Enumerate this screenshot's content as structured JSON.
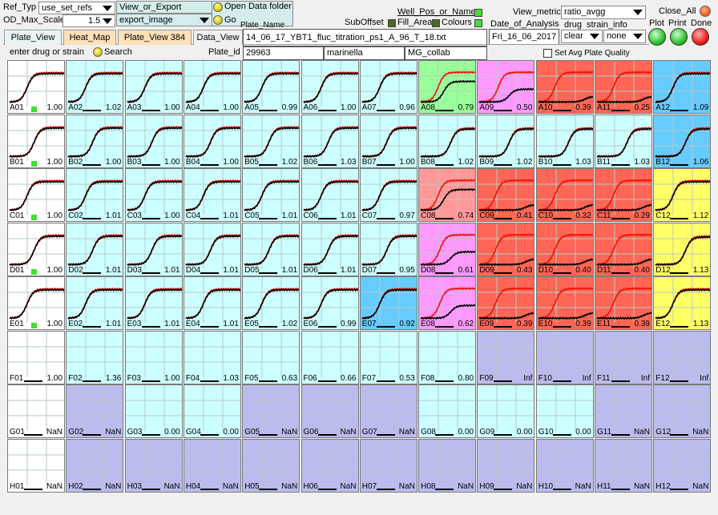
{
  "toolbar": {
    "ref_typ_label": "Ref_Typ",
    "ref_typ_value": "use_set_refs",
    "view_export_label": "View_or_Export",
    "view_export_value": "export_image",
    "od_max_label": "OD_Max_Scale",
    "od_max_value": "1.5",
    "open_folder_label": "Open Data folder",
    "go_label": "Go",
    "plate_name_label": "Plate_Name",
    "plate_name_value": "14_06_17_YBT1_fluc_titration_ps1_A_96_T_18.txt",
    "well_pos_label": "Well_Pos_or_Name",
    "suboffset_label": "SubOffset",
    "fill_area_label": "Fill_Area",
    "colours_label": "Colours",
    "date_label": "Date_of_Analysis",
    "date_value": "Fri_16_06_2017",
    "view_metric_label": "View_metric",
    "view_metric_value": "ratio_avgg",
    "drug_label": "drug",
    "strain_info_label": "strain_info",
    "drug_value": "clear",
    "strain_value": "none",
    "close_all_label": "Close_All",
    "plot_label": "Plot",
    "print_label": "Print",
    "done_label": "Done",
    "search_placeholder": "enter drug or strain",
    "search_label": "Search",
    "plate_id_label": "Plate_id",
    "plate_id_value": "29963",
    "user_value": "marinella",
    "collab_value": "MG_collab",
    "set_avg_label": "Set Avg Plate Quality"
  },
  "tabs": [
    {
      "label": "Plate_View",
      "bg": "#e8f4f4"
    },
    {
      "label": "Heat_Map",
      "bg": "#ffe0b8"
    },
    {
      "label": "Plate_View 384",
      "bg": "#ffe0b8"
    },
    {
      "label": "Data_View",
      "bg": "#f0f0f0"
    }
  ],
  "colors": {
    "cyan": "#ccffff",
    "green": "#99ff99",
    "pink": "#ff99ff",
    "red": "#ff6655",
    "lightred": "#ff9999",
    "blue": "#66ccff",
    "yellow": "#ffff66",
    "white": "#ffffff",
    "empty": "#bbbbee",
    "flat": "#ccffff"
  },
  "plate": {
    "rows": [
      {
        "wells": [
          {
            "id": "A01",
            "value": "1.00",
            "color": "white",
            "curve": "std",
            "mark": true
          },
          {
            "id": "A02",
            "value": "1.02",
            "color": "cyan",
            "curve": "std"
          },
          {
            "id": "A03",
            "value": "1.00",
            "color": "cyan",
            "curve": "std"
          },
          {
            "id": "A04",
            "value": "1.00",
            "color": "cyan",
            "curve": "std"
          },
          {
            "id": "A05",
            "value": "0.99",
            "color": "cyan",
            "curve": "std"
          },
          {
            "id": "A06",
            "value": "1.00",
            "color": "cyan",
            "curve": "std"
          },
          {
            "id": "A07",
            "value": "0.96",
            "color": "cyan",
            "curve": "std"
          },
          {
            "id": "A08",
            "value": "0.79",
            "color": "green",
            "curve": "low"
          },
          {
            "id": "A09",
            "value": "0.50",
            "color": "pink",
            "curve": "lower"
          },
          {
            "id": "A10",
            "value": "0.39",
            "color": "red",
            "curve": "min"
          },
          {
            "id": "A11",
            "value": "0.25",
            "color": "red",
            "curve": "min"
          },
          {
            "id": "A12",
            "value": "1.09",
            "color": "blue",
            "curve": "std"
          }
        ]
      },
      {
        "wells": [
          {
            "id": "B01",
            "value": "1.00",
            "color": "white",
            "curve": "stdlate",
            "mark": true
          },
          {
            "id": "B02",
            "value": "1.00",
            "color": "cyan",
            "curve": "stdlate"
          },
          {
            "id": "B03",
            "value": "1.00",
            "color": "cyan",
            "curve": "stdlate"
          },
          {
            "id": "B04",
            "value": "1.00",
            "color": "cyan",
            "curve": "stdlate"
          },
          {
            "id": "B05",
            "value": "1.02",
            "color": "cyan",
            "curve": "stdlate"
          },
          {
            "id": "B06",
            "value": "1.03",
            "color": "cyan",
            "curve": "stdlate"
          },
          {
            "id": "B07",
            "value": "1.00",
            "color": "cyan",
            "curve": "stdlate"
          },
          {
            "id": "B08",
            "value": "1.02",
            "color": "cyan",
            "curve": "vlate"
          },
          {
            "id": "B09",
            "value": "1.02",
            "color": "cyan",
            "curve": "vlate"
          },
          {
            "id": "B10",
            "value": "1.03",
            "color": "cyan",
            "curve": "vlate"
          },
          {
            "id": "B11",
            "value": "1.03",
            "color": "cyan",
            "curve": "vlate"
          },
          {
            "id": "B12",
            "value": "1.06",
            "color": "blue",
            "curve": "vlate"
          }
        ]
      },
      {
        "wells": [
          {
            "id": "C01",
            "value": "1.00",
            "color": "white",
            "curve": "std",
            "mark": true
          },
          {
            "id": "C02",
            "value": "1.01",
            "color": "cyan",
            "curve": "std"
          },
          {
            "id": "C03",
            "value": "1.00",
            "color": "cyan",
            "curve": "std"
          },
          {
            "id": "C04",
            "value": "1.01",
            "color": "cyan",
            "curve": "std"
          },
          {
            "id": "C05",
            "value": "1.01",
            "color": "cyan",
            "curve": "std"
          },
          {
            "id": "C06",
            "value": "1.01",
            "color": "cyan",
            "curve": "std"
          },
          {
            "id": "C07",
            "value": "0.97",
            "color": "cyan",
            "curve": "std"
          },
          {
            "id": "C08",
            "value": "0.74",
            "color": "lightred",
            "curve": "low"
          },
          {
            "id": "C09",
            "value": "0.41",
            "color": "red",
            "curve": "min"
          },
          {
            "id": "C10",
            "value": "0.32",
            "color": "red",
            "curve": "min"
          },
          {
            "id": "C11",
            "value": "0.29",
            "color": "red",
            "curve": "min"
          },
          {
            "id": "C12",
            "value": "1.12",
            "color": "yellow",
            "curve": "std"
          }
        ]
      },
      {
        "wells": [
          {
            "id": "D01",
            "value": "1.00",
            "color": "white",
            "curve": "stdlate",
            "mark": true
          },
          {
            "id": "D02",
            "value": "1.01",
            "color": "cyan",
            "curve": "stdlate"
          },
          {
            "id": "D03",
            "value": "1.01",
            "color": "cyan",
            "curve": "stdlate"
          },
          {
            "id": "D04",
            "value": "1.01",
            "color": "cyan",
            "curve": "stdlate"
          },
          {
            "id": "D05",
            "value": "1.01",
            "color": "cyan",
            "curve": "stdlate"
          },
          {
            "id": "D06",
            "value": "1.01",
            "color": "cyan",
            "curve": "stdlate"
          },
          {
            "id": "D07",
            "value": "0.95",
            "color": "cyan",
            "curve": "stdlate"
          },
          {
            "id": "D08",
            "value": "0.61",
            "color": "pink",
            "curve": "lower"
          },
          {
            "id": "D09",
            "value": "0.43",
            "color": "red",
            "curve": "min"
          },
          {
            "id": "D10",
            "value": "0.40",
            "color": "red",
            "curve": "min"
          },
          {
            "id": "D11",
            "value": "0.40",
            "color": "red",
            "curve": "min"
          },
          {
            "id": "D12",
            "value": "1.13",
            "color": "yellow",
            "curve": "vlate"
          }
        ]
      },
      {
        "wells": [
          {
            "id": "E01",
            "value": "1.00",
            "color": "white",
            "curve": "std",
            "mark": true
          },
          {
            "id": "E02",
            "value": "1.01",
            "color": "cyan",
            "curve": "std"
          },
          {
            "id": "E03",
            "value": "1.01",
            "color": "cyan",
            "curve": "std"
          },
          {
            "id": "E04",
            "value": "1.01",
            "color": "cyan",
            "curve": "std"
          },
          {
            "id": "E05",
            "value": "1.02",
            "color": "cyan",
            "curve": "std"
          },
          {
            "id": "E06",
            "value": "0.99",
            "color": "cyan",
            "curve": "std"
          },
          {
            "id": "E07",
            "value": "0.92",
            "color": "blue",
            "curve": "std"
          },
          {
            "id": "E08",
            "value": "0.62",
            "color": "pink",
            "curve": "lower"
          },
          {
            "id": "E09",
            "value": "0.39",
            "color": "red",
            "curve": "min"
          },
          {
            "id": "E10",
            "value": "0.39",
            "color": "red",
            "curve": "min"
          },
          {
            "id": "E11",
            "value": "0.39",
            "color": "red",
            "curve": "min"
          },
          {
            "id": "E12",
            "value": "1.13",
            "color": "yellow",
            "curve": "std"
          }
        ]
      },
      {
        "wells": [
          {
            "id": "F01",
            "value": "1.00",
            "color": "white",
            "curve": "flat"
          },
          {
            "id": "F02",
            "value": "1.36",
            "color": "flat",
            "curve": "flat"
          },
          {
            "id": "F03",
            "value": "1.00",
            "color": "flat",
            "curve": "flat"
          },
          {
            "id": "F04",
            "value": "1.03",
            "color": "flat",
            "curve": "flat"
          },
          {
            "id": "F05",
            "value": "0.63",
            "color": "flat",
            "curve": "flat"
          },
          {
            "id": "F06",
            "value": "0.66",
            "color": "flat",
            "curve": "flat"
          },
          {
            "id": "F07",
            "value": "0.53",
            "color": "flat",
            "curve": "flat"
          },
          {
            "id": "F08",
            "value": "0.80",
            "color": "flat",
            "curve": "flat"
          },
          {
            "id": "F09",
            "value": "Inf",
            "color": "empty",
            "curve": "flat"
          },
          {
            "id": "F10",
            "value": "Inf",
            "color": "empty",
            "curve": "flat"
          },
          {
            "id": "F11",
            "value": "Inf",
            "color": "empty",
            "curve": "flat"
          },
          {
            "id": "F12",
            "value": "Inf",
            "color": "empty",
            "curve": "flat"
          }
        ]
      },
      {
        "wells": [
          {
            "id": "G01",
            "value": "NaN",
            "color": "white",
            "curve": "flat"
          },
          {
            "id": "G02",
            "value": "NaN",
            "color": "empty",
            "curve": "flat"
          },
          {
            "id": "G03",
            "value": "0.00",
            "color": "flat",
            "curve": "flat"
          },
          {
            "id": "G04",
            "value": "0.00",
            "color": "flat",
            "curve": "flat"
          },
          {
            "id": "G05",
            "value": "NaN",
            "color": "empty",
            "curve": "flat"
          },
          {
            "id": "G06",
            "value": "NaN",
            "color": "empty",
            "curve": "flat"
          },
          {
            "id": "G07",
            "value": "NaN",
            "color": "empty",
            "curve": "flat"
          },
          {
            "id": "G08",
            "value": "0.00",
            "color": "flat",
            "curve": "flat"
          },
          {
            "id": "G09",
            "value": "0.00",
            "color": "flat",
            "curve": "flat"
          },
          {
            "id": "G10",
            "value": "0.00",
            "color": "flat",
            "curve": "flat"
          },
          {
            "id": "G11",
            "value": "NaN",
            "color": "empty",
            "curve": "flat"
          },
          {
            "id": "G12",
            "value": "NaN",
            "color": "empty",
            "curve": "flat"
          }
        ]
      },
      {
        "wells": [
          {
            "id": "H01",
            "value": "NaN",
            "color": "white",
            "curve": "flat"
          },
          {
            "id": "H02",
            "value": "NaN",
            "color": "empty",
            "curve": "flat"
          },
          {
            "id": "H03",
            "value": "NaN",
            "color": "empty",
            "curve": "flat"
          },
          {
            "id": "H04",
            "value": "NaN",
            "color": "empty",
            "curve": "flat"
          },
          {
            "id": "H05",
            "value": "NaN",
            "color": "empty",
            "curve": "flat"
          },
          {
            "id": "H06",
            "value": "NaN",
            "color": "empty",
            "curve": "flat"
          },
          {
            "id": "H07",
            "value": "NaN",
            "color": "empty",
            "curve": "flat"
          },
          {
            "id": "H08",
            "value": "NaN",
            "color": "empty",
            "curve": "flat"
          },
          {
            "id": "H09",
            "value": "NaN",
            "color": "empty",
            "curve": "flat"
          },
          {
            "id": "H10",
            "value": "NaN",
            "color": "empty",
            "curve": "flat"
          },
          {
            "id": "H11",
            "value": "NaN",
            "color": "empty",
            "curve": "flat"
          },
          {
            "id": "H12",
            "value": "NaN",
            "color": "empty",
            "curve": "flat"
          }
        ]
      }
    ]
  }
}
